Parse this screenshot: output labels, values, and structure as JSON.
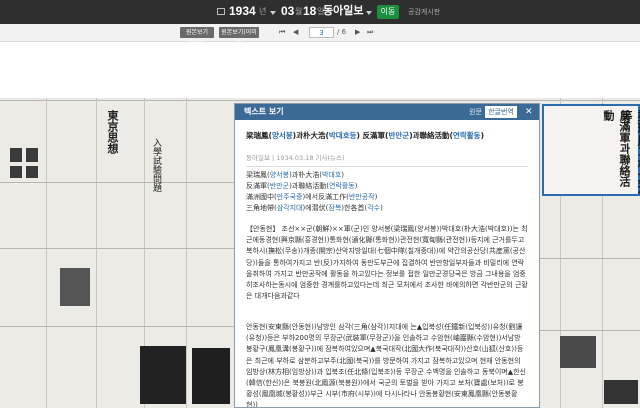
{
  "header": {
    "year": "1934",
    "year_unit": "년",
    "month": "03",
    "month_unit": "월",
    "day": "18",
    "day_unit": "일",
    "publication": "동아일보",
    "move_button": "이동",
    "notice_label": "공감게시판"
  },
  "toolbar": {
    "view_buttons": [
      "원본보기(PDF)",
      "원본보기(이미지)"
    ],
    "current_page": "3",
    "total_pages": "/ 6"
  },
  "article": {
    "panel_title": "텍스트 보기",
    "tab_original": "원문",
    "tab_korean": "한글번역",
    "close_symbol": "✕",
    "headline_parts": [
      {
        "t": "梁瑞鳳(",
        "c": "plain"
      },
      {
        "t": "양서봉",
        "c": "blue"
      },
      {
        "t": ")과朴大浩(",
        "c": "plain"
      },
      {
        "t": "박대호등",
        "c": "blue"
      },
      {
        "t": ") 反滿軍(",
        "c": "plain"
      },
      {
        "t": "반만군",
        "c": "blue"
      },
      {
        "t": ")과聯絡活動(",
        "c": "plain"
      },
      {
        "t": "연락활동",
        "c": "blue"
      },
      {
        "t": ")",
        "c": "plain"
      }
    ],
    "meta": "동아일보 | 1934.03.18 기사(뉴스)",
    "subheads": [
      [
        {
          "t": "梁瑞鳳(",
          "c": "plain"
        },
        {
          "t": "양서봉",
          "c": "blue"
        },
        {
          "t": ")과朴大浩(",
          "c": "plain"
        },
        {
          "t": "박대호",
          "c": "blue"
        },
        {
          "t": ")",
          "c": "plain"
        }
      ],
      [
        {
          "t": "反滿軍(",
          "c": "plain"
        },
        {
          "t": "반만군",
          "c": "blue"
        },
        {
          "t": ")과聯絡活動(",
          "c": "plain"
        },
        {
          "t": "연락활동",
          "c": "blue"
        },
        {
          "t": ")",
          "c": "plain"
        }
      ],
      [
        {
          "t": "滿洲國中(",
          "c": "plain"
        },
        {
          "t": "만주국중",
          "c": "blue"
        },
        {
          "t": ")에서反滿工作(",
          "c": "plain"
        },
        {
          "t": "반만공작",
          "c": "blue"
        },
        {
          "t": ")",
          "c": "plain"
        }
      ],
      [
        {
          "t": "三角地帶(",
          "c": "plain"
        },
        {
          "t": "삼각지대",
          "c": "blue"
        },
        {
          "t": ")에潜伏(",
          "c": "plain"
        },
        {
          "t": "잠복",
          "c": "blue"
        },
        {
          "t": ")한各首(",
          "c": "plain"
        },
        {
          "t": "각수",
          "c": "blue"
        },
        {
          "t": ")",
          "c": "plain"
        }
      ]
    ],
    "paragraph1": "【안동현】 조선××군(朝鮮)××軍(군)인 양서봉(梁瑞鳳(양서봉))박대호(朴大浩(박대호))는 최근에동경현(興京縣(흥경현))통화현(通化縣(통화현))관전현(寬甸縣(관전현))등지에 근거를두고 복하시(撫松(무송))개종(開宗)산악지방일대(七個中隊(칠개중대))에 약간의공산당(共産黨(공산당))들을 통하여가지고 반(反)가지하여 동만도부근에 집결하여 반만항일부자들과 비밀리에 연락을취하여 가지고 반만공작에 활동을 하고있다는 정보를 접한 일만군경당국은 방금 그내용을 엄중히조사하는동시에 엄중한 경계를하고있다는데 최근 모처에서 조사한 바에의하면 각반만군의 근황은 대개다음과같다",
    "paragraph2": "안동현(安東縣(안동현))남방인 삼각(三角(삼각))지대에 는▲입북성(任鐵新(입북성))유청(劉讓(유청))등은 부하200명의 무장군(武裝軍(무장군))을 인솔하고 수암현(岫巖縣(수암현))서남방 봉황구(鳳凰溝(봉황구))에 잠복하여있으며▲북국대작(北國大作(북국대작))산호(山狐(산호))등은 최근에 부하로 삼분하고부주(北國(북국))를 방문하여 가지고 잠복하고있으며 현재 안동현의 임방상(林方相(임방상))과 입북조(任北條(입북조))등 무장군 수백명을 인솔하고 동북이며▲한신(韓信(한신))은 북봉원(北鳳源(북봉원))에서 국군의 토벌을 받아 가지고 보처(寶處(보처))로 봉황성(鳳凰城(봉황성))부근 시부(市府(시부))에 다시나타나 안동봉황현(安東鳳凰縣(안동봉황현))"
  },
  "scan_text": {
    "right_headline": "梁瑞鳳과朴大浩等",
    "right_sub": "反滿軍과聯絡活動",
    "left_a": "東京思想",
    "left_b": "入學試驗問題"
  },
  "colors": {
    "topbar": "#2f2f2f",
    "move_button": "#1a8f3c",
    "panel_header": "#3c6a96",
    "link_blue": "#2b6cb0",
    "highlight_box": "#2b6cb0"
  }
}
